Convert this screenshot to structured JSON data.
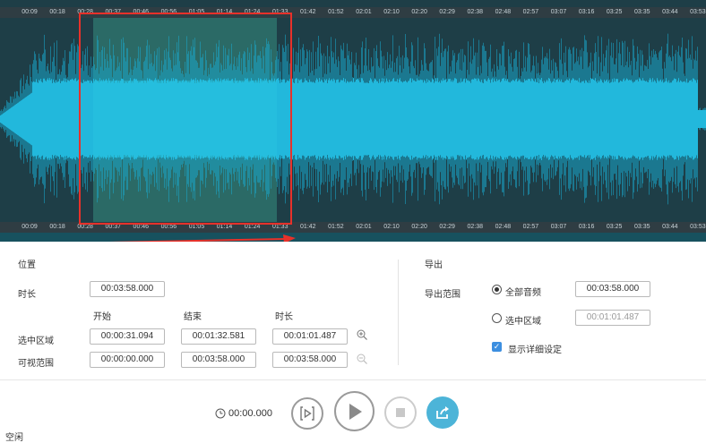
{
  "timeline": {
    "ticks": [
      "00:09",
      "00:18",
      "00:28",
      "00:37",
      "00:46",
      "00:56",
      "01:05",
      "01:14",
      "01:24",
      "01:33",
      "01:42",
      "01:52",
      "02:01",
      "02:10",
      "02:20",
      "02:29",
      "02:38",
      "02:48",
      "02:57",
      "03:07",
      "03:16",
      "03:25",
      "03:35",
      "03:44",
      "03:53"
    ],
    "selection_start_fraction": 0.13,
    "selection_end_fraction": 0.39
  },
  "colors": {
    "wave": "#1aa7cc",
    "wave_core": "#22b8dc",
    "selection_wave": "#2ac6e0",
    "background": "#1e3e47",
    "accent": "#3d8fe0",
    "annotation": "#e8312a"
  },
  "position": {
    "title": "位置",
    "duration_label": "时长",
    "duration_value": "00:03:58.000",
    "col_start": "开始",
    "col_end": "结束",
    "col_length": "时长",
    "rows": [
      {
        "label": "选中区域",
        "start": "00:00:31.094",
        "end": "00:01:32.581",
        "length": "00:01:01.487"
      },
      {
        "label": "可视范围",
        "start": "00:00:00.000",
        "end": "00:03:58.000",
        "length": "00:03:58.000"
      }
    ]
  },
  "export": {
    "title": "导出",
    "range_label": "导出范围",
    "option_all": "全部音频",
    "option_all_value": "00:03:58.000",
    "option_selection": "选中区域",
    "option_selection_value": "00:01:01.487",
    "show_details": "显示详细设定"
  },
  "transport": {
    "time": "00:00.000"
  },
  "status": "空闲",
  "icons": {
    "zoom_in": "zoom-in-icon",
    "zoom_out": "zoom-out-icon",
    "clock": "clock-icon",
    "play_selection": "play-selection-icon",
    "play": "play-icon",
    "stop": "stop-icon",
    "export": "export-icon"
  }
}
